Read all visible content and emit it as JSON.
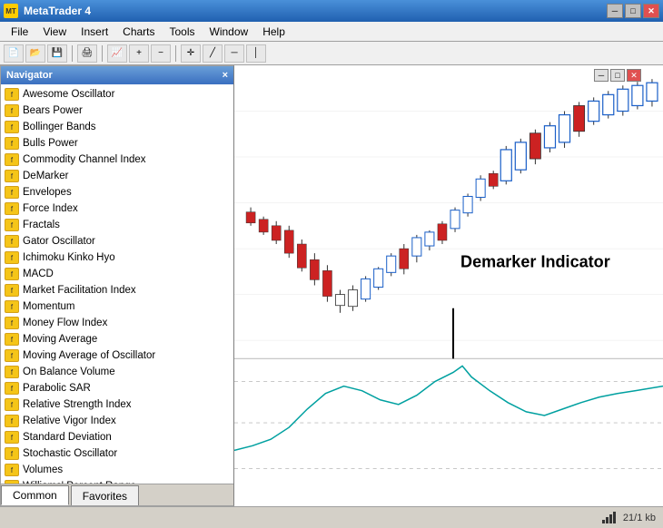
{
  "titlebar": {
    "title": "MetaTrader 4",
    "icon": "MT",
    "buttons": {
      "minimize": "─",
      "maximize": "□",
      "close": "✕"
    }
  },
  "menubar": {
    "items": [
      "File",
      "View",
      "Insert",
      "Charts",
      "Tools",
      "Window",
      "Help"
    ]
  },
  "navigator": {
    "title": "Navigator",
    "close_label": "×",
    "items": [
      "Awesome Oscillator",
      "Bears Power",
      "Bollinger Bands",
      "Bulls Power",
      "Commodity Channel Index",
      "DeMarker",
      "Envelopes",
      "Force Index",
      "Fractals",
      "Gator Oscillator",
      "Ichimoku Kinko Hyo",
      "MACD",
      "Market Facilitation Index",
      "Momentum",
      "Money Flow Index",
      "Moving Average",
      "Moving Average of Oscillator",
      "On Balance Volume",
      "Parabolic SAR",
      "Relative Strength Index",
      "Relative Vigor Index",
      "Standard Deviation",
      "Stochastic Oscillator",
      "Volumes",
      "Williams' Percent Range"
    ],
    "tabs": [
      "Common",
      "Favorites"
    ]
  },
  "chart": {
    "annotation": "Demarker Indicator",
    "annotation_line": true
  },
  "statusbar": {
    "bars_label": "21/1 kb"
  }
}
